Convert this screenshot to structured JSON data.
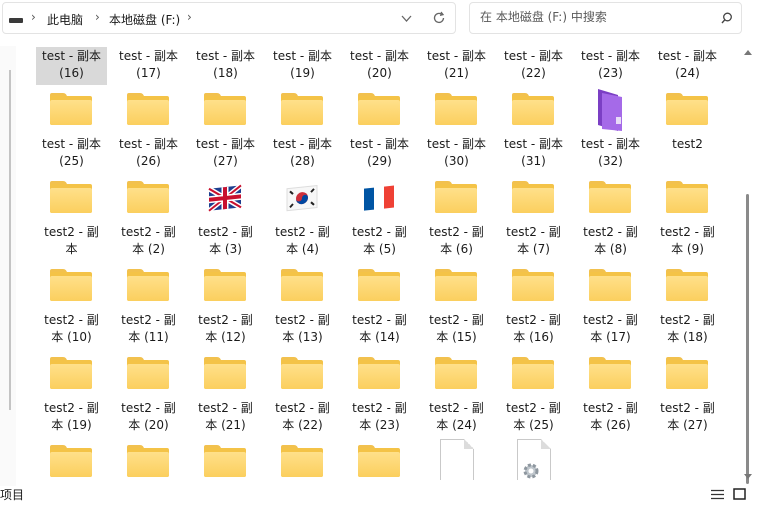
{
  "address": {
    "crumbs": [
      "此电脑",
      "本地磁盘 (F:)"
    ],
    "separator": "›"
  },
  "search": {
    "placeholder": "在 本地磁盘 (F:) 中搜索"
  },
  "status": {
    "count_text": "项目"
  },
  "rows": [
    {
      "labels": [
        [
          "test - 副本",
          "(16)"
        ],
        [
          "test - 副本",
          "(17)"
        ],
        [
          "test - 副本",
          "(18)"
        ],
        [
          "test - 副本",
          "(19)"
        ],
        [
          "test - 副本",
          "(20)"
        ],
        [
          "test - 副本",
          "(21)"
        ],
        [
          "test - 副本",
          "(22)"
        ],
        [
          "test - 副本",
          "(23)"
        ],
        [
          "test - 副本",
          "(24)"
        ]
      ]
    },
    {
      "labels": [
        [
          "test - 副本",
          "(25)"
        ],
        [
          "test - 副本",
          "(26)"
        ],
        [
          "test - 副本",
          "(27)"
        ],
        [
          "test - 副本",
          "(28)"
        ],
        [
          "test - 副本",
          "(29)"
        ],
        [
          "test - 副本",
          "(30)"
        ],
        [
          "test - 副本",
          "(31)"
        ],
        [
          "test - 副本",
          "(32)"
        ],
        [
          "test2",
          ""
        ]
      ]
    },
    {
      "labels": [
        [
          "test2 - 副",
          "本"
        ],
        [
          "test2 - 副",
          "本 (2)"
        ],
        [
          "test2 - 副",
          "本 (3)"
        ],
        [
          "test2 - 副",
          "本 (4)"
        ],
        [
          "test2 - 副",
          "本 (5)"
        ],
        [
          "test2 - 副",
          "本 (6)"
        ],
        [
          "test2 - 副",
          "本 (7)"
        ],
        [
          "test2 - 副",
          "本 (8)"
        ],
        [
          "test2 - 副",
          "本 (9)"
        ]
      ]
    },
    {
      "labels": [
        [
          "test2 - 副",
          "本 (10)"
        ],
        [
          "test2 - 副",
          "本 (11)"
        ],
        [
          "test2 - 副",
          "本 (12)"
        ],
        [
          "test2 - 副",
          "本 (13)"
        ],
        [
          "test2 - 副",
          "本 (14)"
        ],
        [
          "test2 - 副",
          "本 (15)"
        ],
        [
          "test2 - 副",
          "本 (16)"
        ],
        [
          "test2 - 副",
          "本 (17)"
        ],
        [
          "test2 - 副",
          "本 (18)"
        ]
      ]
    },
    {
      "labels": [
        [
          "test2 - 副",
          "本 (19)"
        ],
        [
          "test2 - 副",
          "本 (20)"
        ],
        [
          "test2 - 副",
          "本 (21)"
        ],
        [
          "test2 - 副",
          "本 (22)"
        ],
        [
          "test2 - 副",
          "本 (23)"
        ],
        [
          "test2 - 副",
          "本 (24)"
        ],
        [
          "test2 - 副",
          "本 (25)"
        ],
        [
          "test2 - 副",
          "本 (26)"
        ],
        [
          "test2 - 副",
          "本 (27)"
        ]
      ]
    }
  ],
  "colors": {
    "folder": "#f4c347",
    "folder_front": "#fbcf5e",
    "selection": "#d9d9d9",
    "purple_folder": "#9b5de5"
  }
}
